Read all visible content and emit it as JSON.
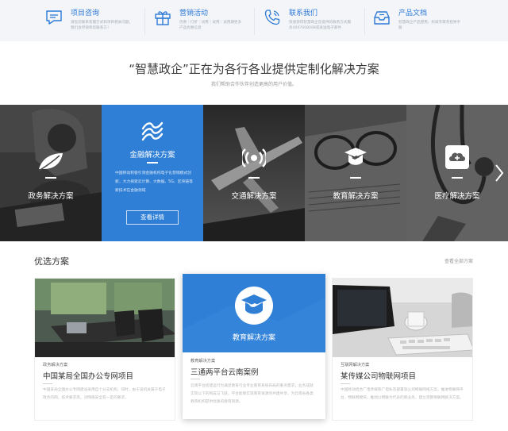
{
  "topbar": {
    "items": [
      {
        "icon": "chat-bubble-icon",
        "title": "项目咨询",
        "desc": "请您您联系客服方式和项目相关问题，我们会尽快和您联系方！"
      },
      {
        "icon": "gift-icon",
        "title": "营销活动",
        "desc": "优惠｜打折｜试用｜试用｜试用期更多产品优惠信息"
      },
      {
        "icon": "phone-icon",
        "title": "联系我们",
        "desc": "快速获得智慧政企您提供的联系方式服务4007008008或发送电子邮件"
      },
      {
        "icon": "inbox-icon",
        "title": "产品文档",
        "desc": "智慧政企产品使用，权威专属有指导手册"
      }
    ]
  },
  "heading": "“智慧政企”正在为各行各业提供定制化解决方案",
  "subheading": "我们帮助合作伙伴创造更高的用户价值。",
  "solutions": [
    {
      "name": "政务解决方案",
      "icon": "leaf-icon"
    },
    {
      "name": "金融解决方案",
      "icon": "finance-waves-icon",
      "desc": "中国移动积极引领金融机构电子化营销模式创新，大力探索云计算、大数据、5G、区块链等新技术在金融领域",
      "button": "查看详情"
    },
    {
      "name": "交通解决方案",
      "icon": "signal-icon"
    },
    {
      "name": "教育解决方案",
      "icon": "education-cap-icon"
    },
    {
      "name": "医疗解决方案",
      "icon": "cloud-plus-icon"
    }
  ],
  "section": {
    "title": "优选方案",
    "more": "查看全部方案"
  },
  "cards": [
    {
      "category": "政务解决方案",
      "title": "中国某局全国办公专网项目",
      "desc": "中国某局全国办公专网建设采用自个分支机构，同时，由于该机关属于电子政务内网，技术要求高，对网络安全有一定的要求。"
    },
    {
      "category": "教育解决方案",
      "title": "三通两平台云南案例",
      "overlay": "教育解决方案",
      "desc": "云南平台搭建运行为满足教育行业专业教育系统布局的重点需求，业务成就实现以下的构成与飞跃，平台能够实现教育资源的共建共享，为云南省各类教育机构提供优质的教育资源。"
    },
    {
      "category": "互联网解决方案",
      "title": "某传媒公司物联网项目",
      "desc": "中国移动结合广电传媒和广电私有部署等公司物联网络方案，推进物联网平台，物联网模块，推动以物联为代表的新业务，建立完整物联网解决方案。"
    }
  ],
  "colors": {
    "accent": "#2f7fd6",
    "topbar_bg": "#f3f5f8"
  }
}
